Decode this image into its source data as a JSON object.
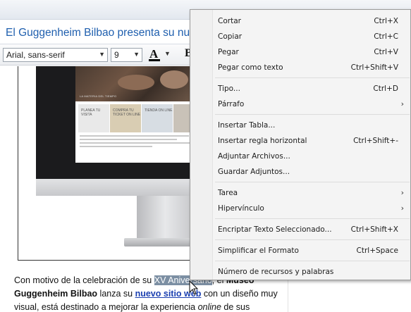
{
  "document": {
    "title": "El Guggenheim Bilbao presenta su nuev"
  },
  "toolbar": {
    "font_family": "Arial, sans-serif",
    "font_size": "9",
    "text_color_glyph": "A",
    "bold_glyph": "B"
  },
  "image": {
    "screen_caption": "LA MATERIA DEL TIEMPO",
    "tiles": [
      {
        "text": "PLANEA TU VISITA",
        "color": "#e9e9e9"
      },
      {
        "text": "COMPRA TU TICKET ON LINE",
        "color": "#d9cdb3"
      },
      {
        "text": "TIENDA ON LINE",
        "color": "#d7dde3"
      },
      {
        "text": "",
        "color": "#c9c2b8"
      }
    ]
  },
  "article": {
    "p1": "Con motivo de la celebración de su ",
    "highlight": "XV Aniversario",
    "p2": ", el ",
    "bold1": "Museo",
    "bold2": "Guggenheim Bilbao",
    "p3": " lanza su ",
    "link": "nuevo sitio web",
    "p4": " con un diseño muy",
    "p5": "visual, está destinado a mejorar la experiencia ",
    "italic": "online",
    "p6": " de sus"
  },
  "context_menu": {
    "items": [
      {
        "label": "Cortar",
        "shortcut": "Ctrl+X"
      },
      {
        "label": "Copiar",
        "shortcut": "Ctrl+C"
      },
      {
        "label": "Pegar",
        "shortcut": "Ctrl+V"
      },
      {
        "label": "Pegar como texto",
        "shortcut": "Ctrl+Shift+V"
      },
      {
        "label": "Tipo...",
        "shortcut": "Ctrl+D"
      },
      {
        "label": "Párrafo",
        "shortcut": ""
      },
      {
        "label": "Insertar Tabla...",
        "shortcut": ""
      },
      {
        "label": "Insertar regla horizontal",
        "shortcut": "Ctrl+Shift+-"
      },
      {
        "label": "Adjuntar Archivos...",
        "shortcut": ""
      },
      {
        "label": "Guardar Adjuntos...",
        "shortcut": ""
      },
      {
        "label": "Tarea",
        "shortcut": ""
      },
      {
        "label": "Hipervínculo",
        "shortcut": ""
      },
      {
        "label": "Encriptar Texto Seleccionado...",
        "shortcut": "Ctrl+Shift+X"
      },
      {
        "label": "Simplificar el Formato",
        "shortcut": "Ctrl+Space"
      },
      {
        "label": "Número de recursos y palabras",
        "shortcut": ""
      }
    ],
    "submenu_glyph": "›"
  },
  "colors": {
    "title_blue": "#1f5fae",
    "link_blue": "#1a3fb0",
    "selection": "#7c8fa3",
    "menu_bg": "#f4f4f4"
  }
}
